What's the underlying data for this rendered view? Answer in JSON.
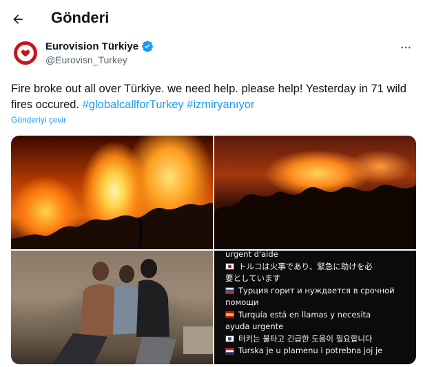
{
  "header": {
    "title": "Gönderi",
    "back_icon": "arrow-left-icon"
  },
  "post": {
    "author": {
      "name": "Eurovision Türkiye",
      "handle": "@Eurovisn_Turkey",
      "verified": true,
      "verified_icon": "verified-badge-icon",
      "avatar_icon": "heart-logo-icon",
      "avatar_color": "#c4161c"
    },
    "more_icon": "more-dots-icon",
    "text": "Fire broke out all over Türkiye. we need help. please help! Yesterday in 71 wild fires occured.",
    "hashtags": [
      "#globalcallforTurkey",
      "#izmiryanıyor"
    ],
    "translate_label": "Gönderiyi çevir",
    "accent_color": "#1d9bf0",
    "media": {
      "text_panel_lines": [
        {
          "flag": "",
          "text": "urgent d'aide"
        },
        {
          "flag": "flag-jp",
          "text": "トルコは火事であり、緊急に助けを必"
        },
        {
          "flag": "",
          "text": "要としています"
        },
        {
          "flag": "flag-ru",
          "text": "Турция горит и нуждается в срочной"
        },
        {
          "flag": "",
          "text": "помощи"
        },
        {
          "flag": "flag-es",
          "text": "Turquía está en llamas y necesita"
        },
        {
          "flag": "",
          "text": "ayuda urgente"
        },
        {
          "flag": "flag-kr",
          "text": "터키는 불타고 긴급한 도움이 필요합니다"
        },
        {
          "flag": "flag-hr",
          "text": "Turska je u plamenu i potrebna joj je"
        }
      ]
    }
  }
}
